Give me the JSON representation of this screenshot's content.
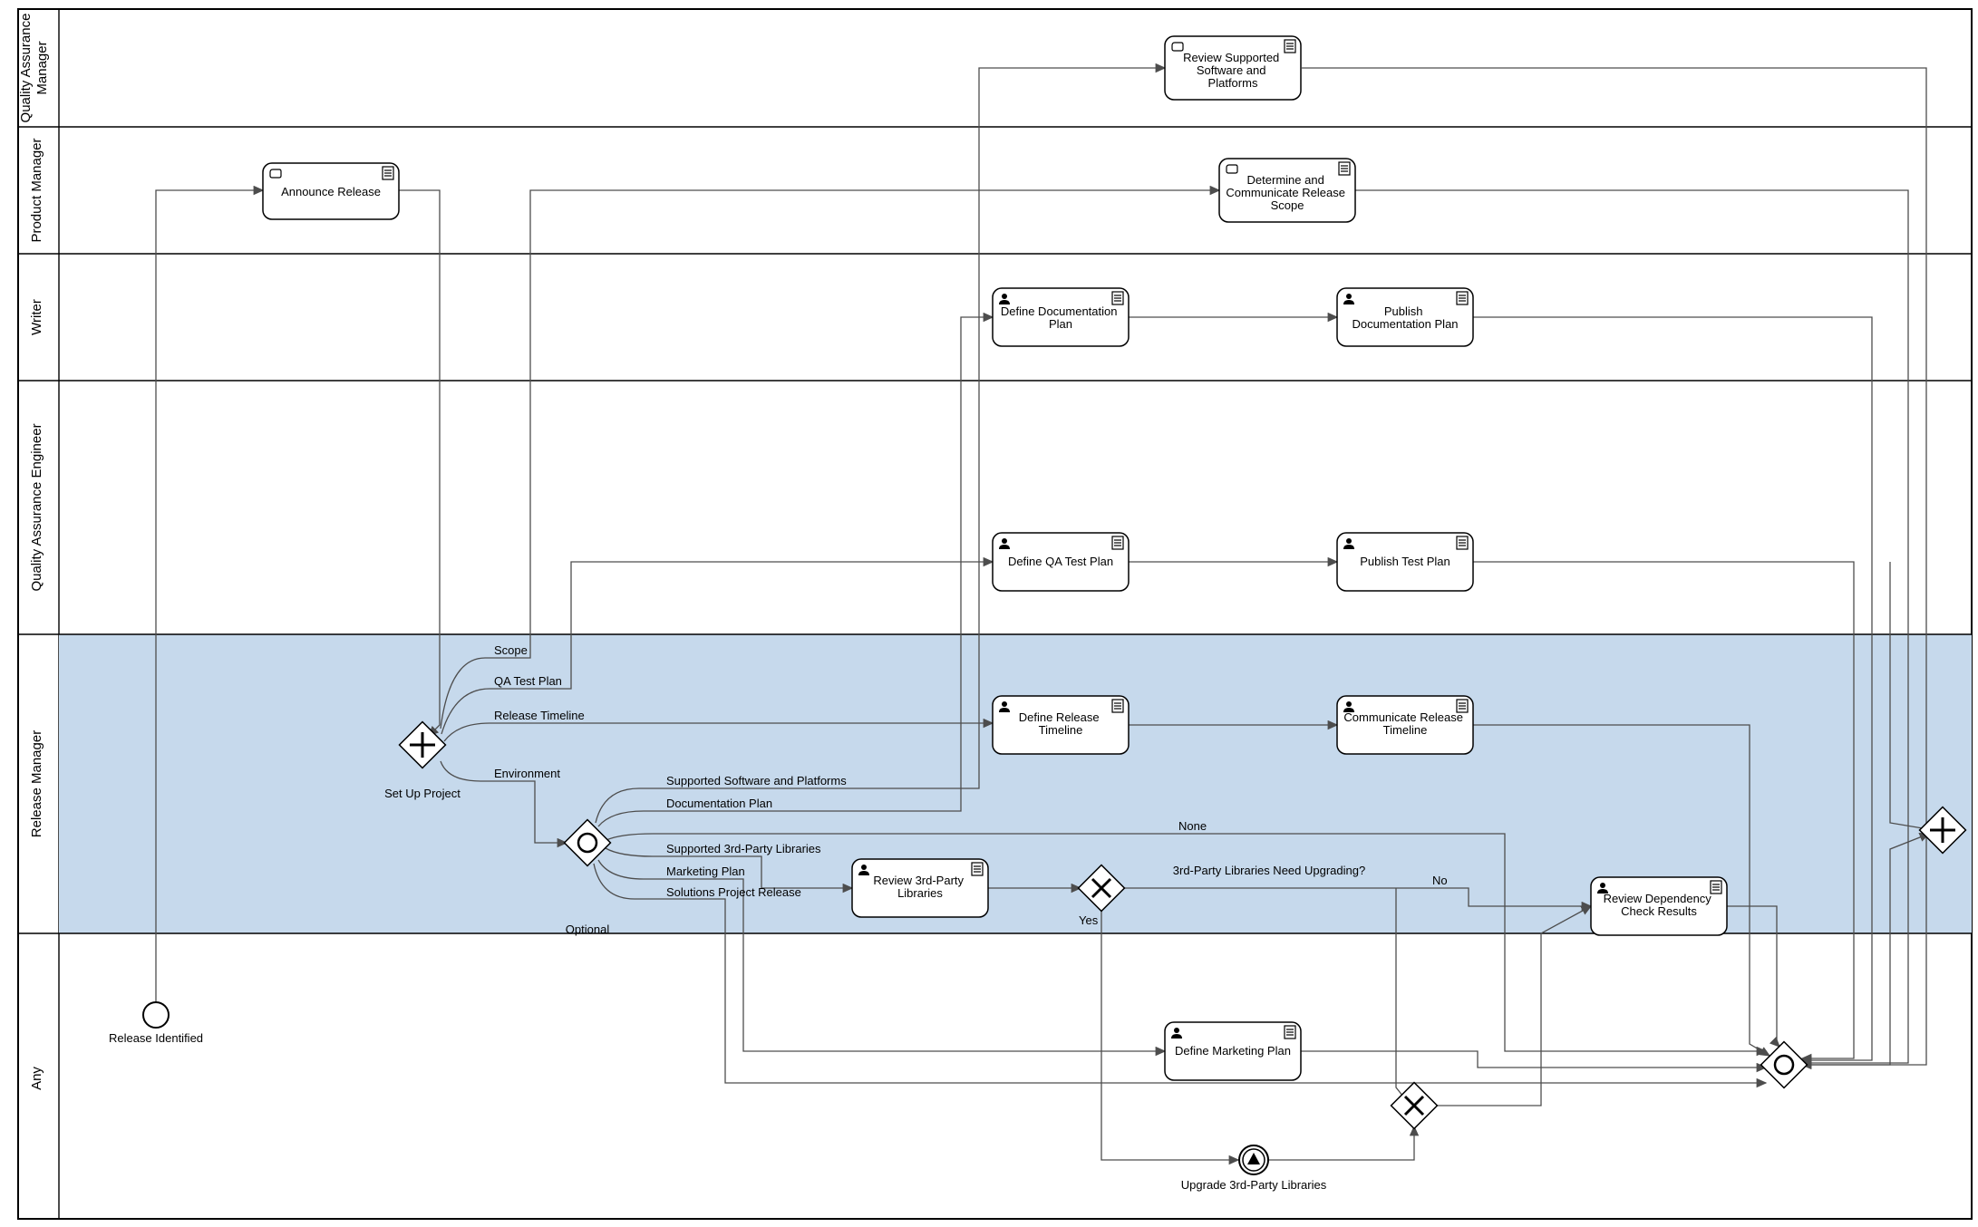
{
  "lanes": {
    "qam": "Quality Assurance Manager",
    "pm": "Product Manager",
    "writer": "Writer",
    "qae": "Quality Assurance Engineer",
    "rm": "Release Manager",
    "any": "Any"
  },
  "events": {
    "start": "Release Identified",
    "upgrade": "Upgrade 3rd-Party Libraries"
  },
  "tasks": {
    "announce": "Announce Release",
    "review_sw_platforms": "Review Supported Software and Platforms",
    "determine_scope": "Determine and Communicate Release Scope",
    "def_doc_plan": "Define Documentation Plan",
    "pub_doc_plan": "Publish Documentation Plan",
    "def_qa_plan": "Define QA Test Plan",
    "pub_test_plan": "Publish Test Plan",
    "def_rel_timeline": "Define Release Timeline",
    "comm_rel_timeline": "Communicate Release Timeline",
    "review_3p": "Review 3rd-Party Libraries",
    "review_dep": "Review Dependency Check Results",
    "def_mkt_plan": "Define Marketing Plan"
  },
  "gateways": {
    "setup_project": "Set Up Project",
    "gw_optional": "Optional",
    "gw_3p_question": "3rd-Party Libraries Need Upgrading?"
  },
  "edge_labels": {
    "scope": "Scope",
    "qa_test_plan": "QA Test Plan",
    "release_timeline": "Release Timeline",
    "environment": "Environment",
    "supported_sw": "Supported Software and Platforms",
    "doc_plan": "Documentation Plan",
    "supported_3p": "Supported 3rd-Party Libraries",
    "marketing_plan": "Marketing Plan",
    "solutions_proj": "Solutions Project Release",
    "none": "None",
    "yes": "Yes",
    "no": "No"
  }
}
